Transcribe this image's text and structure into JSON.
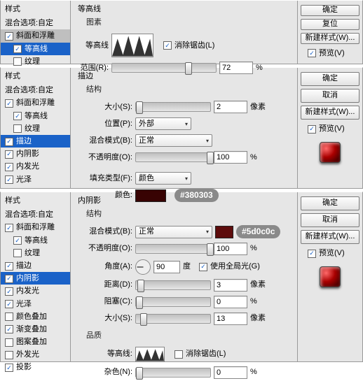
{
  "common": {
    "ok": "确定",
    "reset": "复位",
    "cancel": "取消",
    "newstyle": "新建样式(W)...",
    "preview": "预览(V)",
    "sb_title": "样式",
    "sb_blend": "混合选项:自定",
    "sb_bevel": "斜面和浮雕",
    "sb_contour": "等高线",
    "sb_texture": "纹理",
    "sb_stroke": "描边",
    "sb_ishadow": "内阴影",
    "sb_iglow": "内发光",
    "sb_satin": "光泽",
    "sb_color": "颜色叠加",
    "sb_grad": "渐变叠加",
    "sb_pat": "图案叠加",
    "sb_oglow": "外发光",
    "sb_drop": "投影"
  },
  "p1": {
    "title": "等高线",
    "sub": "图素",
    "anti": "消除锯齿(L)",
    "range": "范围(R):",
    "rangeVal": "72",
    "pct": "%"
  },
  "p2": {
    "title": "描边",
    "sub": "结构",
    "size": "大小(S):",
    "sizeVal": "2",
    "px": "像素",
    "pos": "位置(P):",
    "posVal": "外部",
    "blend": "混合模式(B):",
    "blendVal": "正常",
    "opac": "不透明度(O):",
    "opacVal": "100",
    "pct": "%",
    "filltype": "填充类型(F):",
    "filltypeVal": "颜色",
    "color": "颜色:",
    "colorVal": "#380303",
    "badge": "#380303"
  },
  "p3": {
    "title": "内阴影",
    "sub": "结构",
    "blend": "混合模式(B):",
    "blendVal": "正常",
    "swatch": "#5d0c0c",
    "badge": "#5d0c0c",
    "opac": "不透明度(O):",
    "opacVal": "100",
    "pct": "%",
    "angle": "角度(A):",
    "angleVal": "90",
    "deg": "度",
    "global": "使用全局光(G)",
    "dist": "距离(D):",
    "distVal": "3",
    "px": "像素",
    "choke": "阻塞(C):",
    "chokeVal": "0",
    "size": "大小(S):",
    "sizeVal": "13",
    "qual": "品质",
    "anti": "消除锯齿(L)",
    "contour": "等高线:",
    "noise": "杂色(N):",
    "noiseVal": "0"
  }
}
